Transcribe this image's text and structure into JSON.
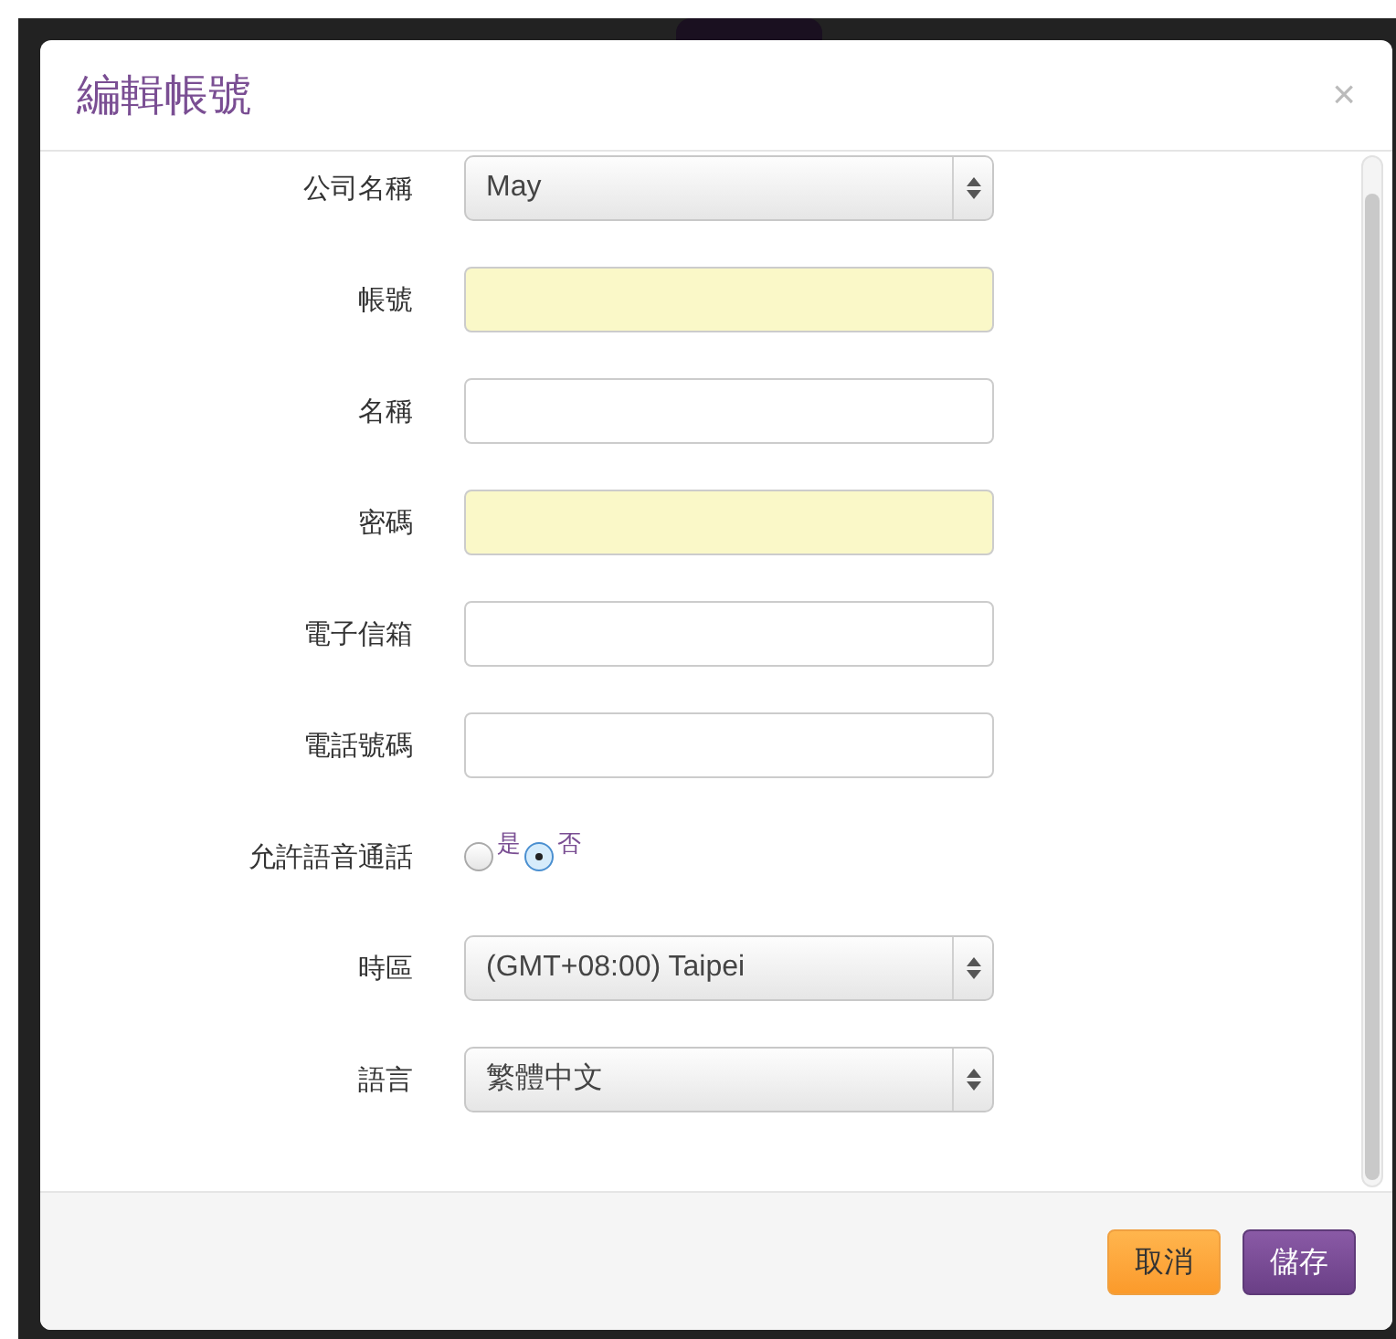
{
  "dialog": {
    "title": "編輯帳號",
    "close": "×"
  },
  "fields": [
    {
      "kind": "select",
      "label": "公司名稱",
      "value": "May"
    },
    {
      "kind": "text",
      "label": "帳號",
      "highlighted": true
    },
    {
      "kind": "text",
      "label": "名稱",
      "highlighted": false
    },
    {
      "kind": "text",
      "label": "密碼",
      "highlighted": true
    },
    {
      "kind": "text",
      "label": "電子信箱",
      "highlighted": false
    },
    {
      "kind": "text",
      "label": "電話號碼",
      "highlighted": false
    },
    {
      "kind": "radio",
      "label": "允許語音通話",
      "options": [
        {
          "label": "是",
          "selected": false
        },
        {
          "label": "否",
          "selected": true
        }
      ]
    },
    {
      "kind": "select",
      "label": "時區",
      "value": "(GMT+08:00) Taipei"
    },
    {
      "kind": "select",
      "label": "語言",
      "value": "繁體中文"
    }
  ],
  "buttons": [
    {
      "kind": "cancel",
      "label": "取消"
    },
    {
      "kind": "save",
      "label": "儲存"
    }
  ]
}
